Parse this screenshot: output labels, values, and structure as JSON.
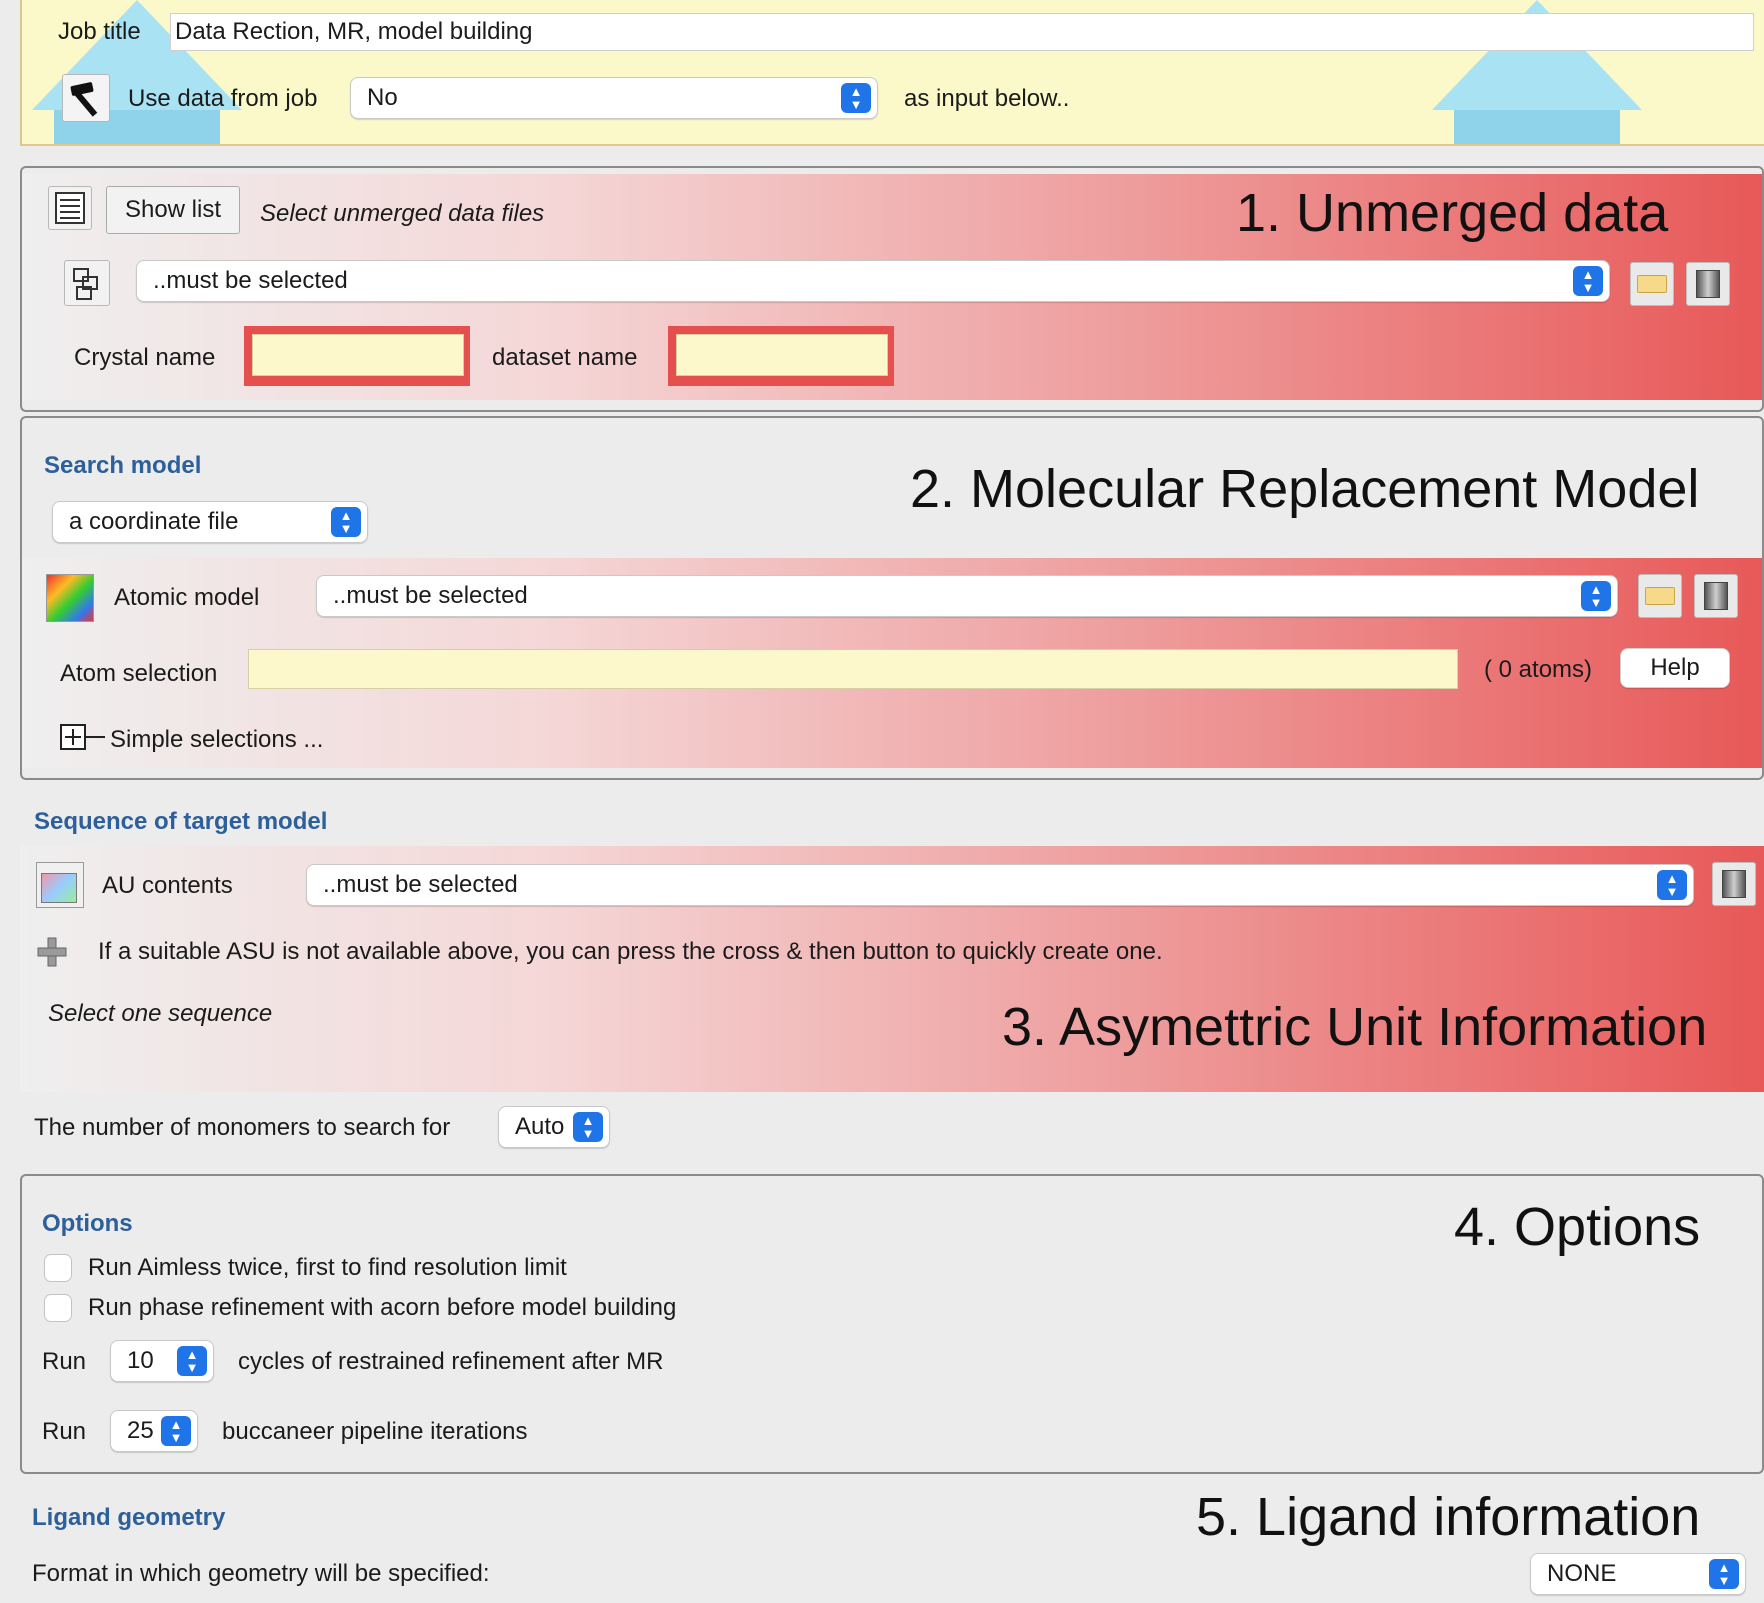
{
  "header": {
    "job_title_label": "Job title",
    "job_title_value": "Data Rection, MR, model building",
    "use_data_label": "Use data from job",
    "use_data_value": "No",
    "use_data_suffix": "as input below.."
  },
  "unmerged": {
    "show_list_label": "Show list",
    "select_hint": "Select unmerged data files",
    "section_heading": "1. Unmerged data",
    "file_value": "..must be selected",
    "crystal_label": "Crystal name",
    "crystal_value": "",
    "dataset_label": "dataset name",
    "dataset_value": ""
  },
  "mr_model": {
    "search_model_title": "Search model",
    "section_heading": "2. Molecular Replacement Model",
    "search_model_value": "a coordinate file",
    "atomic_model_label": "Atomic model",
    "atomic_model_value": "..must be selected",
    "atom_selection_label": "Atom selection",
    "atom_selection_value": "",
    "atom_count": "( 0 atoms)",
    "help_label": "Help",
    "simple_selections_label": "Simple selections ..."
  },
  "asu": {
    "sequence_title": "Sequence of target model",
    "au_contents_label": "AU contents",
    "au_contents_value": "..must be selected",
    "hint": "If a suitable ASU is not available above, you can press the cross & then button to quickly create one.",
    "select_one": "Select one sequence",
    "section_heading": "3. Asymettric Unit Information",
    "monomers_label": "The number of monomers to search for",
    "monomers_value": "Auto"
  },
  "options": {
    "title": "Options",
    "section_heading": "4. Options",
    "aimless_label": "Run Aimless twice, first to find resolution limit",
    "aimless_checked": false,
    "acorn_label": "Run phase refinement with acorn before model building",
    "acorn_checked": false,
    "run_label_1": "Run",
    "refine_cycles": "10",
    "refine_label": "cycles of restrained refinement after MR",
    "run_label_2": "Run",
    "buccaneer_iterations": "25",
    "buccaneer_label": "buccaneer pipeline iterations"
  },
  "ligand": {
    "title": "Ligand geometry",
    "section_heading": "5. Ligand information",
    "format_label": "Format in which geometry will be specified:",
    "format_value": "NONE"
  },
  "colors": {
    "accent": "#1f74e8",
    "section_title": "#2d5f9a",
    "required_red": "#e85858",
    "header_bg": "#fbf9c9",
    "input_yellow": "#fdf8cc"
  }
}
